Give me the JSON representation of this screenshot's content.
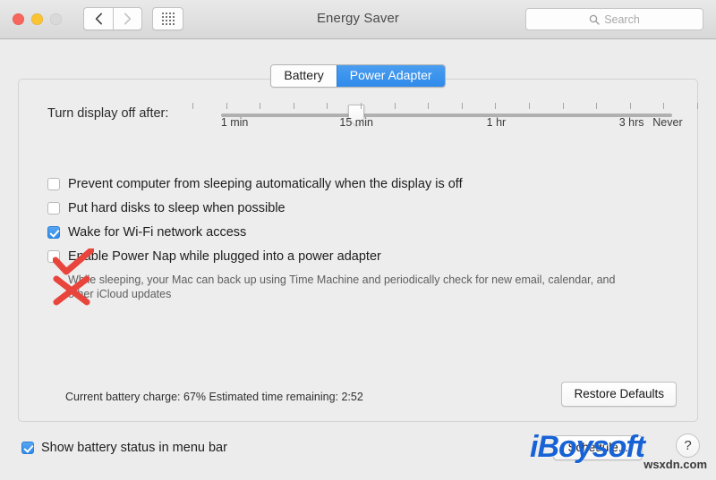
{
  "window": {
    "title": "Energy Saver",
    "traffic_lights": [
      "close",
      "minimize",
      "zoom"
    ]
  },
  "toolbar": {
    "back_icon": "chevron-left-icon",
    "forward_icon": "chevron-right-icon",
    "grid_icon": "grid-apps-icon",
    "search": {
      "icon": "search-icon",
      "placeholder": "Search",
      "value": ""
    }
  },
  "tabs": [
    {
      "label": "Battery",
      "active": false
    },
    {
      "label": "Power Adapter",
      "active": true
    }
  ],
  "slider": {
    "label": "Turn display off after:",
    "value_label": "15 min",
    "thumb_percent": 30,
    "tick_count": 16,
    "tick_labels": [
      {
        "text": "1 min",
        "percent": 3
      },
      {
        "text": "15 min",
        "percent": 30
      },
      {
        "text": "1 hr",
        "percent": 61
      },
      {
        "text": "3 hrs",
        "percent": 91
      },
      {
        "text": "Never",
        "percent": 99
      }
    ]
  },
  "options": [
    {
      "label": "Prevent computer from sleeping automatically when the display is off",
      "checked": false,
      "annotation": "red-check"
    },
    {
      "label": "Put hard disks to sleep when possible",
      "checked": false,
      "annotation": "red-x"
    },
    {
      "label": "Wake for Wi-Fi network access",
      "checked": true,
      "annotation": "none"
    },
    {
      "label": "Enable Power Nap while plugged into a power adapter",
      "checked": false,
      "annotation": "none",
      "description": "While sleeping, your Mac can back up using Time Machine and periodically check for new email, calendar, and other iCloud updates"
    }
  ],
  "status": {
    "text": "Current battery charge: 67%  Estimated time remaining: 2:52",
    "battery_charge": "67%",
    "time_remaining": "2:52"
  },
  "buttons": {
    "restore_defaults": "Restore Defaults",
    "schedule": "Schedule...",
    "help": "?"
  },
  "footer": {
    "show_battery_label": "Show battery status in menu bar",
    "show_battery_checked": true
  },
  "watermark": {
    "brand": "iBoysoft",
    "domain": "wsxdn.com"
  },
  "colors": {
    "accent_blue": "#2f8aea",
    "annotation_red": "#e8453c",
    "watermark_blue": "#1763d6"
  }
}
